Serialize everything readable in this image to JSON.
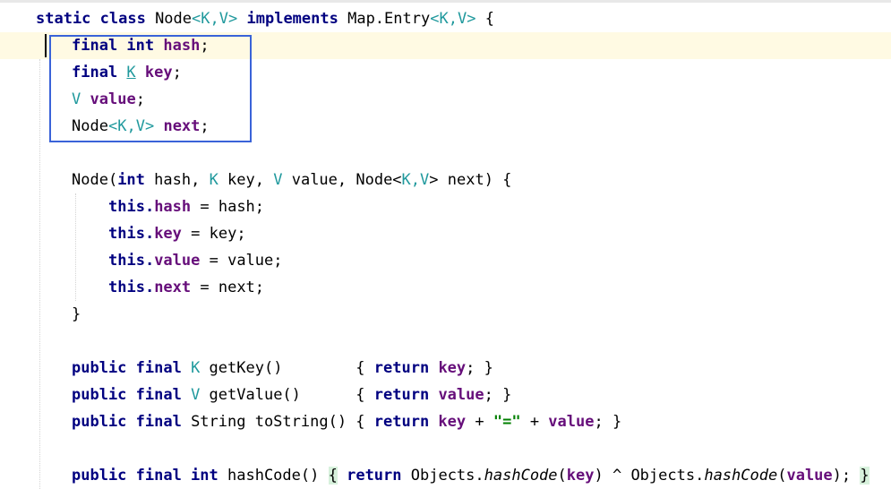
{
  "code": {
    "l1": {
      "kw1": "static class ",
      "name": "Node",
      "lt": "<",
      "t1": "K",
      ",": ",",
      "t2": "V",
      "gt": ">",
      "kw2": " implements ",
      "iface": "Map.Entry",
      "lt2": "<",
      "t3": "K",
      "c2": ",",
      "t4": "V",
      "gt2": ">",
      "tail": " {"
    },
    "l2": {
      "kw": "final int ",
      "fld": "hash",
      "tail": ";"
    },
    "l3": {
      "kw": "final ",
      "tp": "K",
      "sp": " ",
      "fld": "key",
      "tail": ";"
    },
    "l4": {
      "tp": "V",
      "sp": " ",
      "fld": "value",
      "tail": ";"
    },
    "l5": {
      "a": "Node",
      "lt": "<",
      "t1": "K",
      "c": ",",
      "t2": "V",
      "gt": ">",
      "sp": " ",
      "fld": "next",
      "tail": ";"
    },
    "l6": {
      "a": "Node(",
      "kw": "int",
      "b": " hash, ",
      "t1": "K",
      "c": " key, ",
      "t2": "V",
      "d": " value, Node<",
      "t3": "K",
      "e": ",",
      "t4": "V",
      "f": "> next) {"
    },
    "l7": {
      "kw": "this.",
      "fld": "hash",
      "tail": " = hash;"
    },
    "l8": {
      "kw": "this.",
      "fld": "key",
      "tail": " = key;"
    },
    "l9": {
      "kw": "this.",
      "fld": "value",
      "tail": " = value;"
    },
    "l10": {
      "kw": "this.",
      "fld": "next",
      "tail": " = next;"
    },
    "l11": {
      "a": "}"
    },
    "l12": {
      "kw": "public final ",
      "tp": "K",
      "a": " getKey()        { ",
      "ret": "return ",
      "fld": "key",
      "tail": "; }"
    },
    "l13": {
      "kw": "public final ",
      "tp": "V",
      "a": " getValue()      { ",
      "ret": "return ",
      "fld": "value",
      "tail": "; }"
    },
    "l14": {
      "kw": "public final ",
      "a": "String toString() { ",
      "ret": "return ",
      "fld": "key",
      "b": " + ",
      "str": "\"=\"",
      "c": " + ",
      "fld2": "value",
      "tail": "; }"
    },
    "l15": {
      "kw": "public final int ",
      "a": "hashCode() ",
      "b1": "{",
      "sp": " ",
      "ret": "return ",
      "c": "Objects.",
      "m1": "hashCode",
      "d": "(",
      "fld": "key",
      "e": ") ^ Objects.",
      "m2": "hashCode",
      "f": "(",
      "fld2": "value",
      "g": "); ",
      "b2": "}"
    }
  }
}
